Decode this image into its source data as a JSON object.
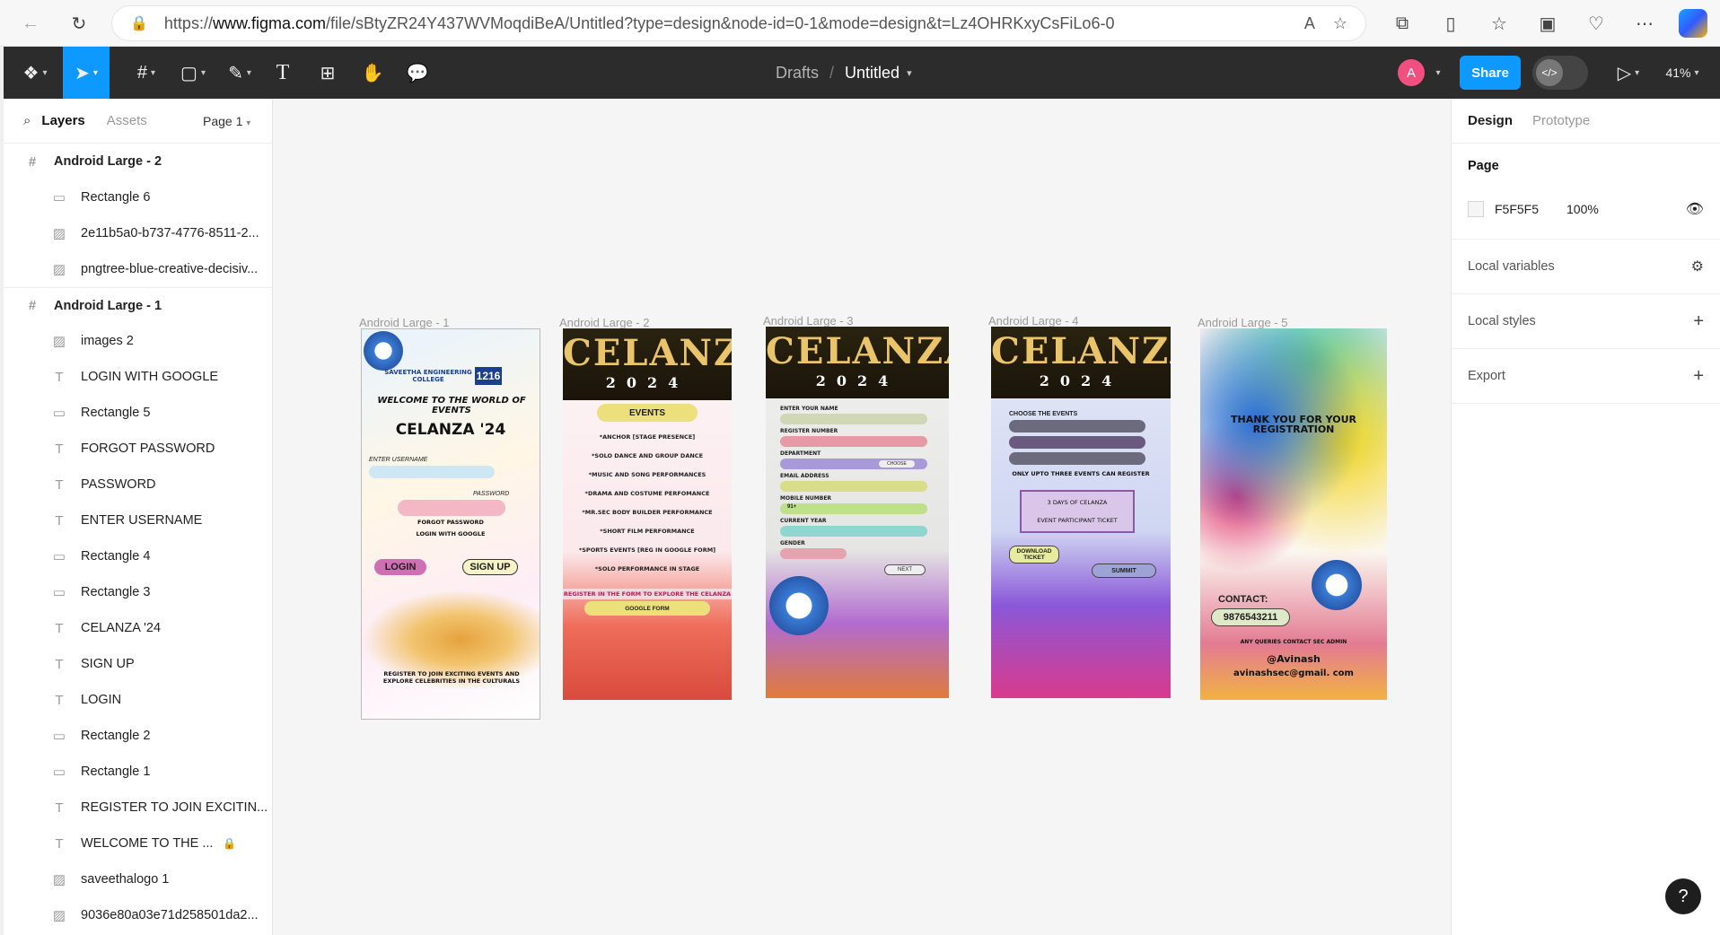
{
  "browser": {
    "url_prefix": "https://",
    "url_host": "www.figma.com",
    "url_path": "/file/sBtyZR24Y437WVMoqdiBeA/Untitled?type=design&node-id=0-1&mode=design&t=Lz4OHRKxyCsFiLo6-0"
  },
  "toolbar": {
    "breadcrumb_parent": "Drafts",
    "breadcrumb_separator": "/",
    "file_title": "Untitled",
    "avatar_initial": "A",
    "share_label": "Share",
    "zoom": "41%"
  },
  "left_panel": {
    "tab_layers": "Layers",
    "tab_assets": "Assets",
    "page_selector": "Page 1",
    "layers": [
      {
        "name": "Android Large - 2",
        "type": "frame"
      },
      {
        "name": "Rectangle 6",
        "type": "rect"
      },
      {
        "name": "2e11b5a0-b737-4776-8511-2...",
        "type": "image"
      },
      {
        "name": "pngtree-blue-creative-decisiv...",
        "type": "image"
      },
      {
        "name": "Android Large - 1",
        "type": "frame"
      },
      {
        "name": "images 2",
        "type": "image"
      },
      {
        "name": "LOGIN WITH GOOGLE",
        "type": "text"
      },
      {
        "name": "Rectangle 5",
        "type": "rect"
      },
      {
        "name": "FORGOT PASSWORD",
        "type": "text"
      },
      {
        "name": "PASSWORD",
        "type": "text"
      },
      {
        "name": "ENTER USERNAME",
        "type": "text"
      },
      {
        "name": "Rectangle 4",
        "type": "rect"
      },
      {
        "name": "Rectangle 3",
        "type": "rect"
      },
      {
        "name": "CELANZA '24",
        "type": "text"
      },
      {
        "name": "SIGN UP",
        "type": "text"
      },
      {
        "name": "LOGIN",
        "type": "text"
      },
      {
        "name": "Rectangle 2",
        "type": "rect"
      },
      {
        "name": "Rectangle 1",
        "type": "rect"
      },
      {
        "name": "REGISTER TO JOIN EXCITIN...",
        "type": "text"
      },
      {
        "name": "WELCOME TO THE ...",
        "type": "text",
        "locked": true
      },
      {
        "name": "saveethalogo 1",
        "type": "image"
      },
      {
        "name": "9036e80a03e71d258501da2...",
        "type": "image"
      }
    ]
  },
  "canvas": {
    "frames": [
      {
        "label": "Android Large - 1"
      },
      {
        "label": "Android Large - 2"
      },
      {
        "label": "Android Large - 3"
      },
      {
        "label": "Android Large - 4"
      },
      {
        "label": "Android Large - 5"
      }
    ],
    "frame1": {
      "welcome": "WELCOME TO THE WORLD OF EVENTS",
      "title": "CELANZA '24",
      "username": "ENTER USERNAME",
      "password": "PASSWORD",
      "forgot": "FORGOT PASSWORD",
      "google": "LOGIN WITH GOOGLE",
      "login": "LOGIN",
      "signup": "SIGN UP",
      "register": "REGISTER TO JOIN EXCITING EVENTS AND EXPLORE CELEBRITIES IN THE CULTURALS",
      "college": "SAVEETHA ENGINEERING COLLEGE",
      "code": "1216"
    },
    "celanza_title": "CELANZA",
    "celanza_year": "2024",
    "frame2": {
      "events_label": "EVENTS",
      "events": [
        "*ANCHOR [STAGE PRESENCE]",
        "*SOLO DANCE AND GROUP DANCE",
        "*MUSIC AND SONG PERFORMANCES",
        "*DRAMA AND COSTUME PERFOMANCE",
        "*MR.SEC BODY BUILDER PERFORMANCE",
        "*SHORT FILM PERFORMANCE",
        "*SPORTS EVENTS [REG IN GOOGLE FORM]",
        "*SOLO PERFORMANCE IN STAGE"
      ],
      "register_note": "REGISTER IN THE FORM TO EXPLORE THE CELANZA",
      "google_form": "GOOGLE FORM"
    },
    "frame3": {
      "fields": [
        "ENTER YOUR NAME",
        "REGISTER NUMBER",
        "DEPARTMENT",
        "EMAIL ADDRESS",
        "MOBILE NUMBER",
        "CURRENT YEAR",
        "GENDER"
      ],
      "choose": "CHOOSE",
      "mobile_prefix": "91+",
      "next": "NEXT"
    },
    "frame4": {
      "choose_events": "CHOOSE THE EVENTS",
      "limit_note": "ONLY UPTO THREE EVENTS CAN REGISTER",
      "ticket_line1": "3 DAYS OF CELANZA",
      "ticket_line2": "EVENT PARTICIPANT TICKET",
      "download": "DOWNLOAD TICKET",
      "submit": "SUMMIT"
    },
    "frame5": {
      "thanks": "THANK YOU FOR YOUR REGISTRATION",
      "contact_label": "CONTACT:",
      "phone": "9876543211",
      "queries": "ANY QUERIES CONTACT SEC ADMIN",
      "handle": "@Avinash",
      "email": "avinashsec@gmail. com"
    }
  },
  "right_panel": {
    "tab_design": "Design",
    "tab_prototype": "Prototype",
    "page_heading": "Page",
    "page_color": "F5F5F5",
    "page_opacity": "100%",
    "local_variables": "Local variables",
    "local_styles": "Local styles",
    "export": "Export"
  },
  "help_label": "?",
  "colors": {
    "toolbar_bg": "#2c2c2c",
    "accent": "#0d99ff",
    "canvas_bg": "#f5f5f5"
  }
}
